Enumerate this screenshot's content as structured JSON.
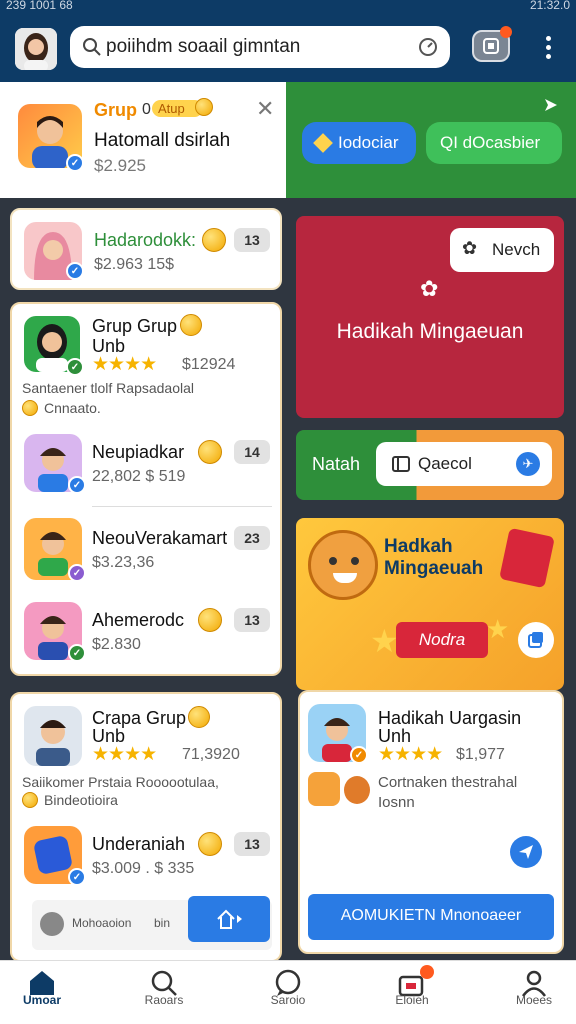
{
  "status_bar": {
    "time_left": "239 1001 68",
    "time_right": "21:32.0"
  },
  "header": {
    "search_value": "poiihdm soaail gimntan",
    "accent": "#0d3b66"
  },
  "featured": {
    "tag": "Grup",
    "tag_zero": "0",
    "badge": "Atup",
    "title": "Hatomall dsirlah",
    "price": "$2.925"
  },
  "top_right": {
    "btn_blue": "Iodociar",
    "btn_green": "QI dOcasbier"
  },
  "list1": {
    "title": "Hadarodokk:",
    "sub": "$2.963 15$",
    "count": "13"
  },
  "group1": {
    "title": "Grup Grup",
    "title2": "Unb",
    "rating_value": "$12924",
    "desc1": "Santaener tlolf Rapsadaolal",
    "desc2": "Cnnaato.",
    "items": [
      {
        "title": "Neupiadkar",
        "sub": "22,802  $ 519",
        "count": "14"
      },
      {
        "title": "NeouVerakamart",
        "sub": "$3.23,36",
        "count": "23"
      },
      {
        "title": "Ahemerodc",
        "sub": "$2.830",
        "count": "13"
      }
    ]
  },
  "group2": {
    "title": "Crapa Grup",
    "title2": "Unb",
    "rating_value": "71,3920",
    "desc1": "Saiikomer Prstaia Roooootulaa,",
    "desc2": "Bindeotioira",
    "items": [
      {
        "title": "Underaniah",
        "sub": "$3.009 . $ 335",
        "count": "13"
      }
    ],
    "mini_text": "Mohoaoion",
    "mini_text2": "bin"
  },
  "promo_red": {
    "chip": "Nevch",
    "title": "Hadikah Mingaeuan"
  },
  "promo_split": {
    "left": "Natah",
    "chip": "Qaecol"
  },
  "promo_yellow": {
    "title1": "Hadkah",
    "title2": "Mingaeuah",
    "ribbon": "Nodra"
  },
  "promo_card": {
    "title": "Hadikah Uargasin",
    "title2": "Unh",
    "rating_value": "$1,977",
    "desc1": "Cortnaken thestrahal",
    "desc2": "Iosnn",
    "button": "AOMUKIETN Mnonoaeer"
  },
  "bottom_nav": [
    {
      "label": "Umoar",
      "icon": "home-icon"
    },
    {
      "label": "Raoars",
      "icon": "search-icon"
    },
    {
      "label": "Saroio",
      "icon": "chat-icon"
    },
    {
      "label": "Eloieh",
      "icon": "bag-icon"
    },
    {
      "label": "Moees",
      "icon": "profile-icon"
    }
  ]
}
